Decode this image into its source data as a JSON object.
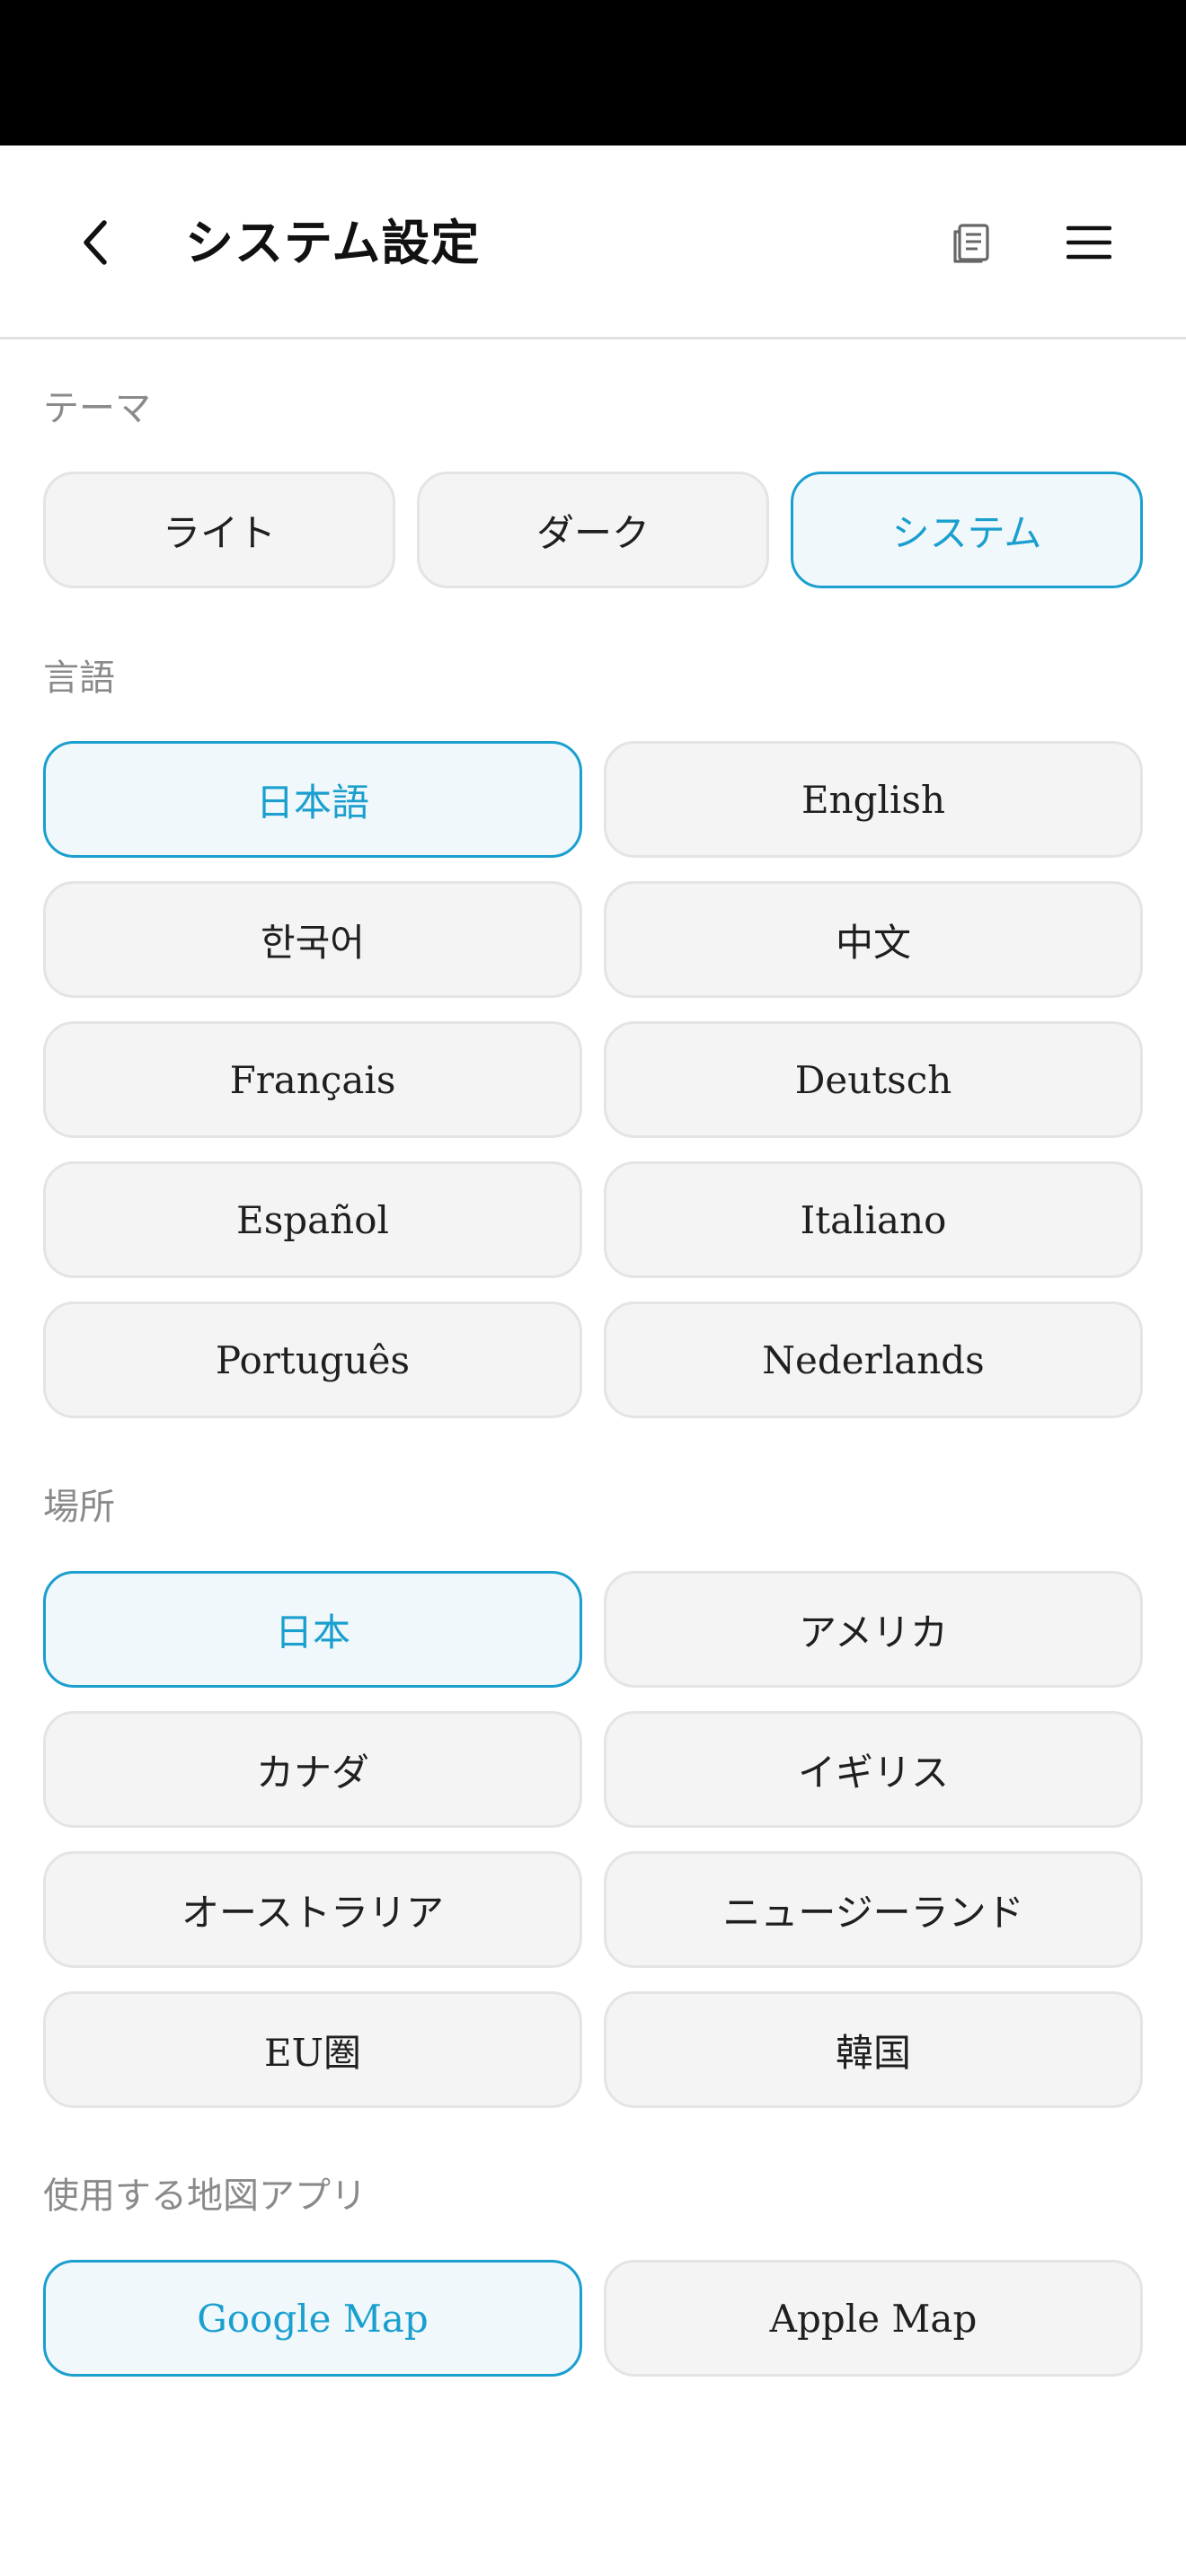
{
  "header": {
    "title": "システム設定",
    "back_icon": "chevron-left-icon",
    "doc_icon": "document-icon",
    "menu_icon": "hamburger-menu-icon"
  },
  "colors": {
    "accent": "#1a9fce",
    "selected_bg": "#f0f8fb",
    "option_bg": "#f4f4f4",
    "label": "#8a8a8a"
  },
  "theme": {
    "label": "テーマ",
    "options": [
      "ライト",
      "ダーク",
      "システム"
    ],
    "selected": "システム"
  },
  "language": {
    "label": "言語",
    "options": [
      "日本語",
      "English",
      "한국어",
      "中文",
      "Français",
      "Deutsch",
      "Español",
      "Italiano",
      "Português",
      "Nederlands"
    ],
    "selected": "日本語"
  },
  "location": {
    "label": "場所",
    "options": [
      "日本",
      "アメリカ",
      "カナダ",
      "イギリス",
      "オーストラリア",
      "ニュージーランド",
      "EU圏",
      "韓国"
    ],
    "selected": "日本"
  },
  "map_app": {
    "label": "使用する地図アプリ",
    "options": [
      "Google Map",
      "Apple Map"
    ],
    "selected": "Google Map"
  }
}
